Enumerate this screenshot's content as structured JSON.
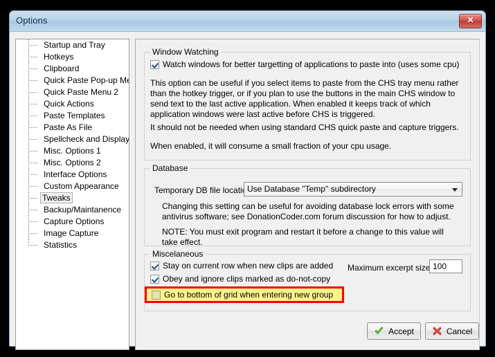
{
  "window": {
    "title": "Options",
    "close_label": "✕"
  },
  "sidebar": {
    "items": [
      {
        "label": "Startup and Tray",
        "selected": false
      },
      {
        "label": "Hotkeys",
        "selected": false
      },
      {
        "label": "Clipboard",
        "selected": false
      },
      {
        "label": "Quick Paste Pop-up Menu",
        "selected": false
      },
      {
        "label": "Quick Paste Menu 2",
        "selected": false
      },
      {
        "label": "Quick Actions",
        "selected": false
      },
      {
        "label": "Paste Templates",
        "selected": false
      },
      {
        "label": "Paste As File",
        "selected": false
      },
      {
        "label": "Spellcheck and Display",
        "selected": false
      },
      {
        "label": "Misc. Options 1",
        "selected": false
      },
      {
        "label": "Misc. Options 2",
        "selected": false
      },
      {
        "label": "Interface Options",
        "selected": false
      },
      {
        "label": "Custom Appearance",
        "selected": false
      },
      {
        "label": "Tweaks",
        "selected": true
      },
      {
        "label": "Backup/Maintanence",
        "selected": false
      },
      {
        "label": "Capture Options",
        "selected": false
      },
      {
        "label": "Image Capture",
        "selected": false
      },
      {
        "label": "Statistics",
        "selected": false
      }
    ]
  },
  "window_watching": {
    "group_title": "Window Watching",
    "checkbox_label": "Watch windows for better targetting of applications to paste into (uses some cpu)",
    "checkbox_checked": true,
    "paragraph1": "This option can be useful if you select items to paste from the CHS tray menu rather than the hotkey trigger, or if you plan to use the buttons in the main CHS window to send text to the last active application.  When enabled it keeps track of which application windows were last active before CHS is triggered.",
    "paragraph2": "It should not be needed when using standard CHS quick paste and capture triggers.",
    "paragraph3": "When enabled, it will consume a small fraction of your cpu usage."
  },
  "database": {
    "group_title": "Database",
    "temp_db_label": "Temporary DB file location:",
    "temp_db_value": "Use Database \"Temp\" subdirectory",
    "note1": "Changing this setting can be useful for avoiding database lock errors with some antivirus software; see DonationCoder.com forum discussion for how to adjust.",
    "note2": "NOTE: You must exit program and restart it before a change to this value will take effect."
  },
  "miscellaneous": {
    "group_title": "Miscelaneous",
    "checkbox1_label": "Stay on current row when new clips are added",
    "checkbox1_checked": true,
    "checkbox2_label": "Obey and ignore clips marked as do-not-copy",
    "checkbox2_checked": true,
    "checkbox3_label": "Go to bottom of grid when entering new group",
    "checkbox3_checked": false,
    "excerpt_label": "Maximum excerpt size:",
    "excerpt_value": "100"
  },
  "footer": {
    "accept_label": "Accept",
    "cancel_label": "Cancel"
  },
  "colors": {
    "highlight_fill": "#fbf58c",
    "highlight_border": "#ff0000",
    "titlebar": "#a8c8e2",
    "accept_glyph": "#5fbf2e",
    "cancel_glyph": "#d94d45"
  }
}
